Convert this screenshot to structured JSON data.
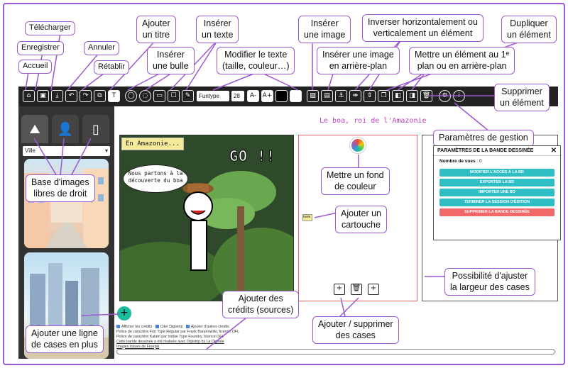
{
  "callouts": {
    "telecharger": "Télécharger",
    "enregistrer": "Enregistrer",
    "accueil": "Accueil",
    "annuler": "Annuler",
    "retablir": "Rétablir",
    "ajouter_titre_1": "Ajouter",
    "ajouter_titre_2": "un titre",
    "inserer_bulle_1": "Insérer",
    "inserer_bulle_2": "une bulle",
    "inserer_texte_1": "Insérer",
    "inserer_texte_2": "un texte",
    "modifier_texte_1": "Modifier le texte",
    "modifier_texte_2": "(taille, couleur…)",
    "inserer_image_1": "Insérer",
    "inserer_image_2": "une image",
    "inserer_image_ap_1": "Insérer une image",
    "inserer_image_ap_2": "en arrière-plan",
    "inverser_1": "Inverser horizontalement ou",
    "inverser_2": "verticalement un élément",
    "dupliquer_1": "Dupliquer",
    "dupliquer_2": "un élément",
    "premier_plan_1": "Mettre un élément au 1ᵉ",
    "premier_plan_2": "plan ou en arrière-plan",
    "supprimer_1": "Supprimer",
    "supprimer_2": "un élément",
    "parametres": "Paramètres de gestion",
    "base_images_1": "Base d'images",
    "base_images_2": "libres de droit",
    "fond_couleur_1": "Mettre un fond",
    "fond_couleur_2": "de couleur",
    "cartouche_1": "Ajouter un",
    "cartouche_2": "cartouche",
    "largeur_1": "Possibilité d'ajuster",
    "largeur_2": "la largeur des cases",
    "credits_1": "Ajouter des",
    "credits_2": "crédits (sources)",
    "cases_1": "Ajouter / supprimer",
    "cases_2": "des cases",
    "ligne_1": "Ajouter une ligne",
    "ligne_2": "de cases en plus"
  },
  "toolbar": {
    "font_select": "Funtype",
    "font_size": "28",
    "decrease_label": "A-",
    "increase_label": "A+",
    "title_label": "T"
  },
  "sidebar": {
    "category_value": "Ville"
  },
  "comic": {
    "title": "Le boa, roi de l'Amazonie",
    "cartouche_text": "En Amazonie...",
    "bubble_line1": "Nous partons à la",
    "bubble_line2": "découverte du boa",
    "sound_effect": "GO !!",
    "small_cartouche": "texte"
  },
  "settings_dialog": {
    "header": "PARAMÈTRES DE LA BANDE DESSINÉE",
    "close": "✕",
    "views_label": "Nombre de vues",
    "views_value": ": 0",
    "buttons": [
      "MODIFIER L'ACCÈS À LA BD",
      "EXPORTER LA BD",
      "IMPORTER UNE BD",
      "TERMINER LA SESSION D'ÉDITION",
      "SUPPRIMER LA BANDE DESSINÉE"
    ]
  },
  "credits_area": {
    "check1": "Afficher les crédits",
    "check2": "Citer Digistrip",
    "check3": "Ajouter d'autres crédits",
    "line1": "Police de caractère Fun Type Regular par Frank Baranowski, licence OFL",
    "line2": "Police de caractère Kalam par Indian Type Foundry, licence OFL",
    "line3": "Cette bande dessinée a été réalisée avec Digistrip by La Digitale",
    "line4": "Images issues de Freepik"
  },
  "colors": {
    "accent": "#9b59d0",
    "toolbar_bg": "#222222",
    "teal_button": "#2ebec4",
    "danger_button": "#f06868",
    "title_color": "#c040c0"
  }
}
